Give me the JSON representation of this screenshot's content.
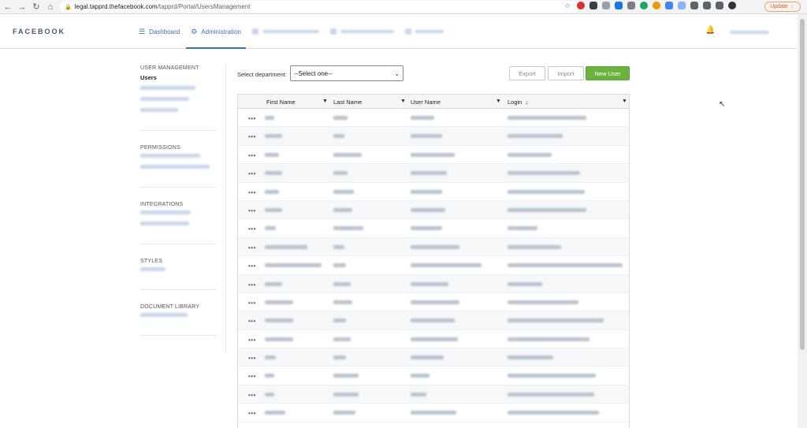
{
  "browser": {
    "url_host": "legal.tapprd.thefacebook.com",
    "url_path": "/tapprd/Portal/UsersManagement",
    "update_label": "Update"
  },
  "header": {
    "brand": "FACEBOOK",
    "nav": [
      {
        "label": "Dashboard",
        "icon": "list-icon"
      },
      {
        "label": "Administration",
        "icon": "gear-icon"
      }
    ]
  },
  "sidebar": {
    "sections": [
      {
        "title": "USER MANAGEMENT",
        "current": "Users"
      },
      {
        "title": "PERMISSIONS"
      },
      {
        "title": "INTEGRATIONS"
      },
      {
        "title": "STYLES"
      },
      {
        "title": "DOCUMENT LIBRARY"
      }
    ]
  },
  "toolbar": {
    "department_label": "Select department:",
    "department_value": "--Select one--",
    "export_label": "Export",
    "import_label": "Import",
    "new_user_label": "New User"
  },
  "table": {
    "columns": [
      "First Name",
      "Last Name",
      "User Name",
      "Login"
    ],
    "sort_indicator": "↓",
    "row_action": "•••",
    "row_count": 17
  }
}
